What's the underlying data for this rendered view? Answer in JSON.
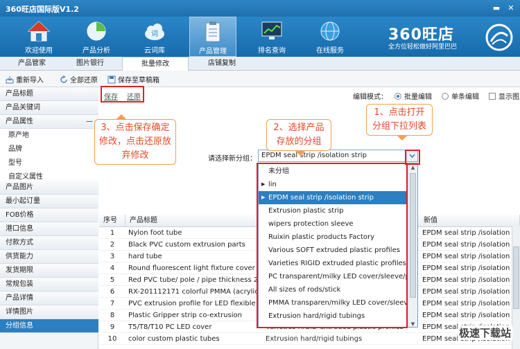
{
  "app": {
    "title": "360旺店国际版V1.2"
  },
  "window_controls": {
    "minimize": "▬",
    "close": "✕"
  },
  "nav": [
    {
      "label": "欢迎使用",
      "icon": "home-icon"
    },
    {
      "label": "产品分析",
      "icon": "pie-chart-icon"
    },
    {
      "label": "云词库",
      "icon": "cloud-icon"
    },
    {
      "label": "产品管理",
      "icon": "clipboard-icon",
      "active": true
    },
    {
      "label": "排名查询",
      "icon": "monitor-chart-icon"
    },
    {
      "label": "在线服务",
      "icon": "globe-icon"
    }
  ],
  "brand": {
    "name": "360旺店",
    "slogan": "全方位轻松做好阿里巴巴"
  },
  "tabs": [
    "产品管家",
    "图片银行",
    "批量修改",
    "店铺复制"
  ],
  "active_tab": 2,
  "toolbar": {
    "reimport": "重新导入",
    "restore_all": "全部还原",
    "save_draft": "保存至草稿箱"
  },
  "sidebar": [
    {
      "label": "产品标题"
    },
    {
      "label": "产品关键词"
    },
    {
      "label": "产品属性",
      "collapse": "—"
    },
    {
      "label": "原产地",
      "sub": true
    },
    {
      "label": "品牌",
      "sub": true
    },
    {
      "label": "型号",
      "sub": true
    },
    {
      "label": "自定义属性",
      "sub": true
    },
    {
      "label": "产品图片"
    },
    {
      "label": "最小起订量"
    },
    {
      "label": "FOB价格"
    },
    {
      "label": "港口信息"
    },
    {
      "label": "付款方式"
    },
    {
      "label": "供货能力"
    },
    {
      "label": "发货期限"
    },
    {
      "label": "常规包装"
    },
    {
      "label": "产品详情"
    },
    {
      "label": "详情图片"
    },
    {
      "label": "分组信息",
      "selected": true
    }
  ],
  "actions": {
    "save": "保存",
    "restore": "还原"
  },
  "edit_mode": {
    "label": "编辑模式：",
    "batch": "批量编辑",
    "single": "单条编辑",
    "show_images": "显示图片"
  },
  "group_select": {
    "label": "请选择新分组：",
    "value": "EPDM seal strip /isolation strip"
  },
  "dropdown_items": [
    {
      "label": "未分组"
    },
    {
      "label": "lin",
      "expand": "▶"
    },
    {
      "label": "EPDM seal strip /isolation strip",
      "expand": "▶",
      "selected": true
    },
    {
      "label": "Extrusion plastic strip"
    },
    {
      "label": "wipers protection sleeve"
    },
    {
      "label": "Ruixin plastic products Factory"
    },
    {
      "label": "Various SOFT extruded plastic profiles"
    },
    {
      "label": "Varieties RIGID extruded plastic profiles"
    },
    {
      "label": "PC transparent/milky LED cover/sleeve/profile"
    },
    {
      "label": "All sizes of rods/stick"
    },
    {
      "label": "PMMA transparen/milky LED cover/sleeve"
    },
    {
      "label": "Extrusion hard/rigid tubings"
    }
  ],
  "table": {
    "headers": {
      "num": "序号",
      "title": "产品标题",
      "new": "新值"
    },
    "rows": [
      {
        "num": "1",
        "title": "Nylon foot tube",
        "new": "EPDM seal strip /isolation st"
      },
      {
        "num": "2",
        "title": "Black PVC custom extrusion parts",
        "new": "EPDM seal strip /isolation st"
      },
      {
        "num": "3",
        "title": "hard tube",
        "new": "EPDM seal strip /isolation st"
      },
      {
        "num": "4",
        "title": "Round fluorescent light fixture cover",
        "new": "EPDM seal strip /isolation st"
      },
      {
        "num": "5",
        "title": "Red PVC tube/ pole / pipe thickness 2mm",
        "new": "EPDM seal strip /isolation st"
      },
      {
        "num": "6",
        "title": "RX-201112171 colorful PMMA (acrylic)rod",
        "new": "EPDM seal strip /isolation st"
      },
      {
        "num": "7",
        "title": "PVC extrusion profile for LED flexible strip",
        "new": "EPDM seal strip /isolation st"
      },
      {
        "num": "8",
        "title": "Plastic Gripper strip co-extrusion",
        "new": "EPDM seal strip /isolation st"
      },
      {
        "num": "9",
        "title": "T5/T8/T10 PC LED cover",
        "old": "Varieties RIGID extruded plastic profiles",
        "new": "EPDM seal strip /isolation st"
      },
      {
        "num": "10",
        "title": "color custom plastic tubes",
        "old": "Extrusion hard/rigid tubings",
        "new": "EPDM seal strip /isolation st"
      }
    ]
  },
  "callouts": {
    "c1": "1、点击打开分组下拉列表",
    "c2": "2、选择产品存放的分组",
    "c3": "3、点击保存确定修改，点击还原放弃修改"
  },
  "watermark": "极速下载站",
  "colors": {
    "header_blue": "#1f6fae",
    "selected_blue": "#2c7fc0",
    "annotation_red": "#e0202a",
    "callout_text": "#e8482a"
  }
}
